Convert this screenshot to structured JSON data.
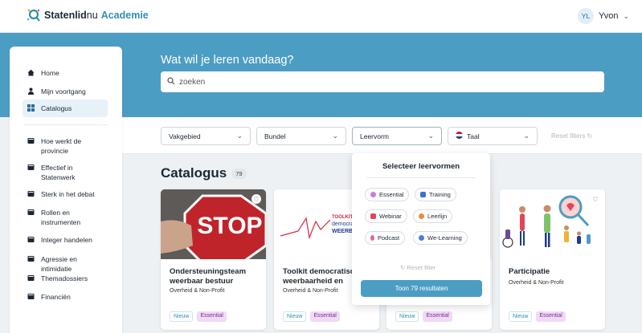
{
  "header": {
    "brand_part1": "Statenlid",
    "brand_part2": "nu",
    "brand_part3": "Academie",
    "user_initials": "YL",
    "user_name": "Yvon"
  },
  "hero": {
    "question": "Wat wil je leren vandaag?",
    "search_placeholder": "zoeken"
  },
  "sidebar": {
    "items": [
      {
        "label": "Home",
        "icon": "home-icon"
      },
      {
        "label": "Mijn voortgang",
        "icon": "person-icon"
      },
      {
        "label": "Catalogus",
        "icon": "grid-icon",
        "active": true
      },
      {
        "label": "Hoe werkt de provincie",
        "icon": "book-icon"
      },
      {
        "label": "Effectief in Statenwerk",
        "icon": "book-icon"
      },
      {
        "label": "Sterk in het debat",
        "icon": "book-icon"
      },
      {
        "label": "Rollen en instrumenten",
        "icon": "book-icon"
      },
      {
        "label": "Integer handelen",
        "icon": "book-icon"
      },
      {
        "label": "Agressie en intimidatie",
        "icon": "book-icon"
      },
      {
        "label": "Themadossiers",
        "icon": "book-icon"
      },
      {
        "label": "Financiën",
        "icon": "book-icon"
      }
    ]
  },
  "filters": {
    "vakgebied": "Vakgebied",
    "bundel": "Bundel",
    "leervorm": "Leervorm",
    "taal": "Taal",
    "reset": "Reset filters"
  },
  "catalog": {
    "title": "Catalogus",
    "count": "79"
  },
  "cards": [
    {
      "title": "Ondersteuningsteam weerbaar bestuur",
      "subtitle": "Overheid & Non-Profit",
      "tag_new": "Nieuw",
      "tag_level": "Essential"
    },
    {
      "title": "Toolkit democratische weerbaarheid en integriteit",
      "subtitle": "Overheid & Non-Profit",
      "tag_new": "Nieuw",
      "tag_level": "Essential"
    },
    {
      "title": "",
      "subtitle": "",
      "tag_new": "Nieuw",
      "tag_level": "Essential"
    },
    {
      "title": "Participatie",
      "subtitle": "Overheid & Non-Profit",
      "tag_new": "Nieuw",
      "tag_level": "Essential"
    }
  ],
  "card_image_text": {
    "stop": "STOP",
    "toolkit_1": "TOOLKIT",
    "toolkit_2": "democratische",
    "toolkit_3": "WEERBAARHEID"
  },
  "leervorm_dropdown": {
    "title": "Selecteer leervormen",
    "options": [
      {
        "label": "Essential",
        "color": "#c77be0"
      },
      {
        "label": "Training",
        "color": "#3f6fd1"
      },
      {
        "label": "Webinar",
        "color": "#e2455b"
      },
      {
        "label": "Leerlijn",
        "color": "#f08a3c"
      },
      {
        "label": "Podcast",
        "color": "#e0679c"
      },
      {
        "label": "We-Learning",
        "color": "#4a7fd4"
      }
    ],
    "reset": "Reset filter",
    "show_results": "Toon 79 resultaten"
  },
  "colors": {
    "accent": "#4c9dc4",
    "essential_bg": "#f1d9f7"
  }
}
